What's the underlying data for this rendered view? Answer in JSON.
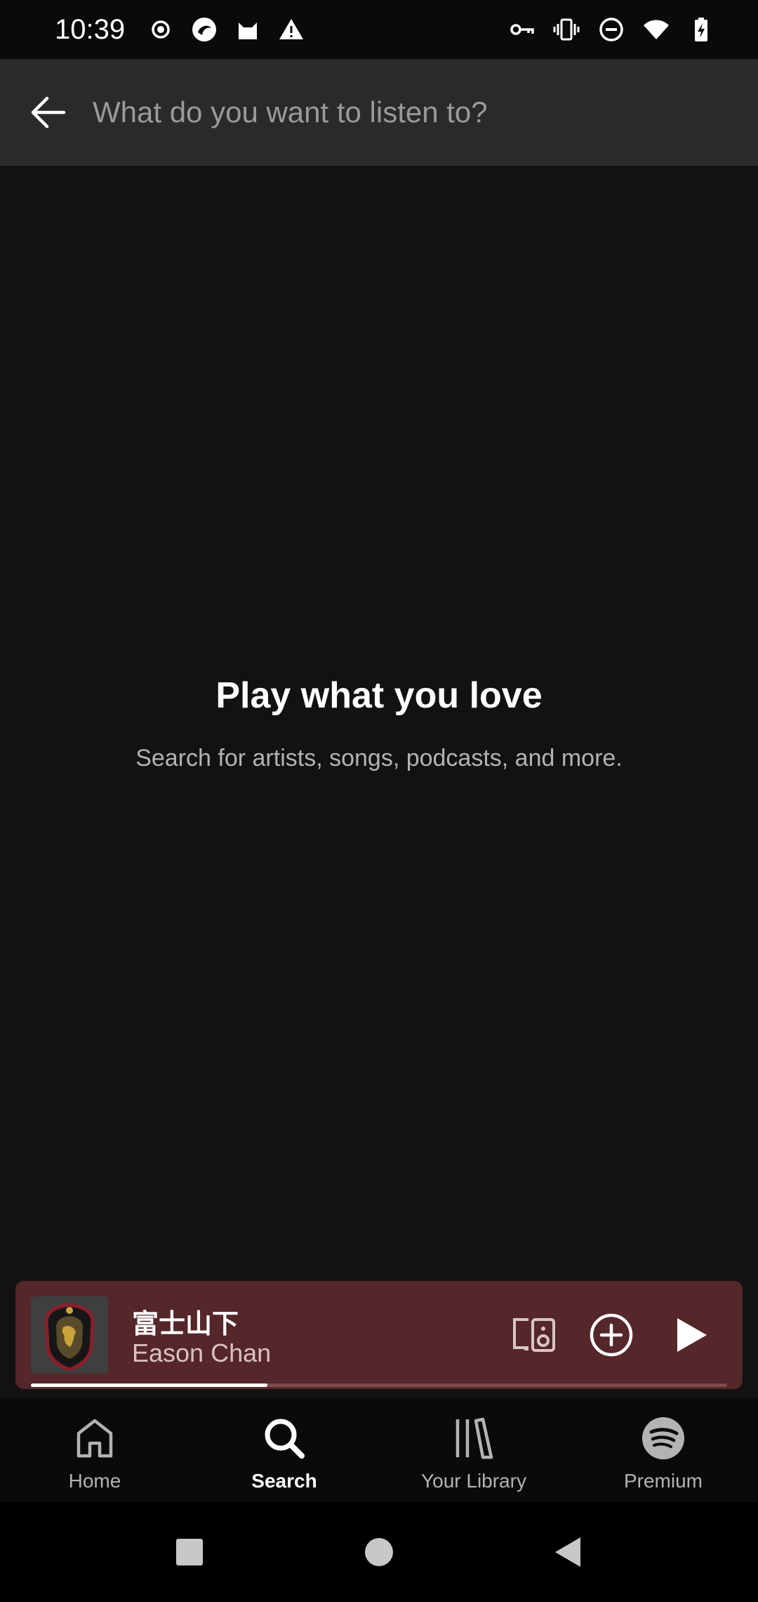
{
  "status_bar": {
    "time": "10:39",
    "left_icons": [
      "record-icon",
      "app-icon",
      "cat-icon",
      "warning-icon"
    ],
    "right_icons": [
      "key-icon",
      "vibrate-icon",
      "do-not-disturb-icon",
      "wifi-icon",
      "battery-charging-icon"
    ]
  },
  "search": {
    "placeholder": "What do you want to listen to?",
    "value": ""
  },
  "empty_state": {
    "title": "Play what you love",
    "subtitle": "Search for artists, songs, podcasts, and more."
  },
  "mini_player": {
    "track_title": "富士山下",
    "artist": "Eason Chan",
    "progress": 0.34,
    "background_color": "#55262a"
  },
  "bottom_nav": {
    "items": [
      {
        "label": "Home",
        "icon": "home-icon",
        "active": false
      },
      {
        "label": "Search",
        "icon": "search-icon",
        "active": true
      },
      {
        "label": "Your Library",
        "icon": "library-icon",
        "active": false
      },
      {
        "label": "Premium",
        "icon": "spotify-logo-icon",
        "active": false
      }
    ]
  },
  "system_nav": {
    "buttons": [
      "recents-button",
      "home-button",
      "back-button"
    ]
  }
}
